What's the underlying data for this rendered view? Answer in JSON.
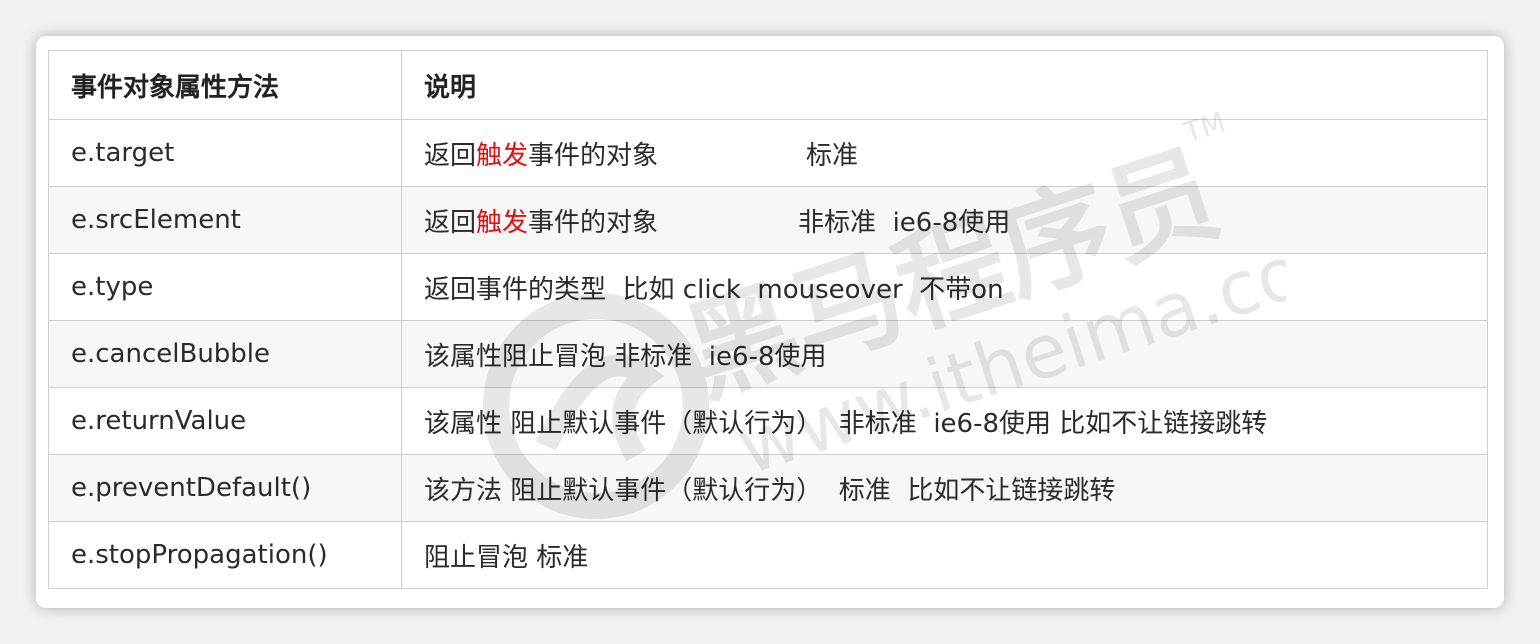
{
  "table": {
    "headers": [
      "事件对象属性方法",
      "说明"
    ],
    "rows": [
      {
        "method": "e.target",
        "desc_pre": "返回",
        "desc_red": "触发",
        "desc_post": "事件的对象",
        "desc_tail": "标准"
      },
      {
        "method": "e.srcElement",
        "desc_pre": "返回",
        "desc_red": "触发",
        "desc_post": "事件的对象",
        "desc_tail": "非标准  ie6-8使用"
      },
      {
        "method": "e.type",
        "desc": "返回事件的类型  比如 click  mouseover  不带on"
      },
      {
        "method": "e.cancelBubble",
        "desc": "该属性阻止冒泡 非标准  ie6-8使用"
      },
      {
        "method": "e.returnValue",
        "desc": "该属性 阻止默认事件（默认行为）  非标准  ie6-8使用 比如不让链接跳转"
      },
      {
        "method": "e.preventDefault()",
        "desc": "该方法 阻止默认事件（默认行为）  标准  比如不让链接跳转"
      },
      {
        "method": "e.stopPropagation()",
        "desc": "阻止冒泡 标准"
      }
    ]
  },
  "watermark": {
    "brand": "黑马程序员",
    "url": "www.itheima.com",
    "tm": "TM"
  },
  "colors": {
    "highlight": "#e01010",
    "border": "#cfcfcf",
    "alt_row": "#f7f7f7"
  }
}
